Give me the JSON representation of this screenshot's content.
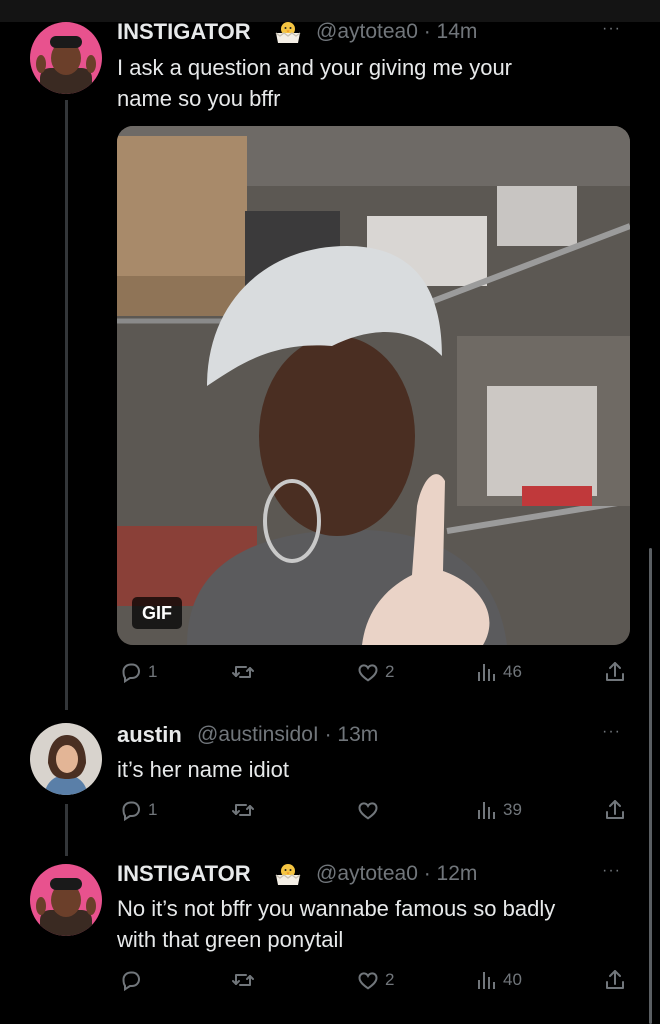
{
  "tweets": [
    {
      "name": "INSTIGATOR",
      "badge_icon": "hatching-chick-icon",
      "handle": "@aytotea0",
      "time": "· 14m",
      "line1": "I ask a question and your giving me your",
      "line2": "name so you bffr",
      "gif_label": "GIF",
      "replies": "1",
      "likes": "2",
      "views": "46"
    },
    {
      "name": "austin",
      "handle": "@austinsidoI",
      "time": "· 13m",
      "line1": "it’s her name idiot",
      "replies": "1",
      "views": "39"
    },
    {
      "name": "INSTIGATOR",
      "badge_icon": "hatching-chick-icon",
      "handle": "@aytotea0",
      "time": "· 12m",
      "line1": "No it’s not bffr you wannabe famous so badly",
      "line2": "with that green ponytail",
      "likes": "2",
      "views": "40"
    }
  ],
  "more_label": "···",
  "colors": {
    "background": "#000000",
    "text": "#e7e9ea",
    "secondary": "#71767b",
    "thread_line": "#333639"
  }
}
